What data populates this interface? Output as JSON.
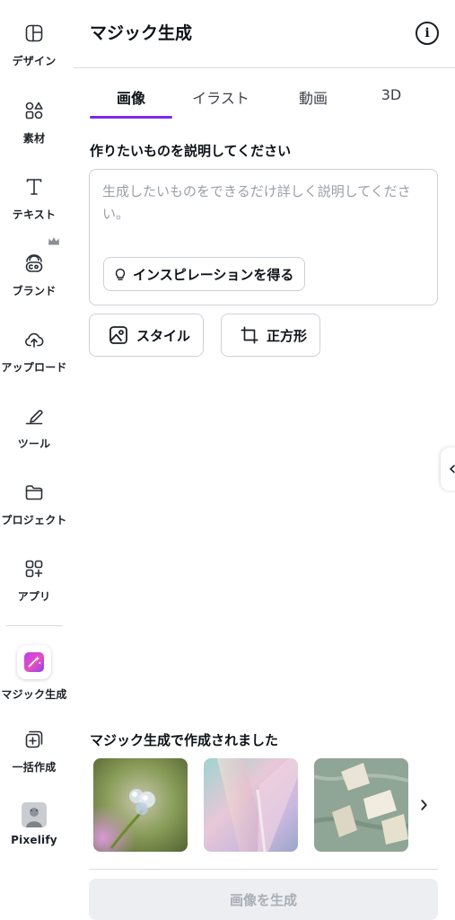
{
  "sidebar": {
    "items": [
      {
        "label": "デザイン",
        "icon": "layout-icon"
      },
      {
        "label": "素材",
        "icon": "shapes-icon"
      },
      {
        "label": "テキスト",
        "icon": "text-icon"
      },
      {
        "label": "ブランド",
        "icon": "brand-icon"
      },
      {
        "label": "アップロード",
        "icon": "cloud-upload-icon"
      },
      {
        "label": "ツール",
        "icon": "pen-tool-icon"
      },
      {
        "label": "プロジェクト",
        "icon": "folder-icon"
      },
      {
        "label": "アプリ",
        "icon": "apps-grid-icon"
      },
      {
        "label": "マジック生成",
        "icon": "magic-sparkle-icon",
        "active": true
      },
      {
        "label": "一括作成",
        "icon": "bulk-create-icon"
      },
      {
        "label": "Pixelify",
        "icon": "pixelify-app-icon"
      }
    ]
  },
  "panel": {
    "title": "マジック生成",
    "tabs": [
      {
        "label": "画像",
        "active": true
      },
      {
        "label": "イラスト"
      },
      {
        "label": "動画"
      },
      {
        "label": "3D"
      }
    ],
    "prompt": {
      "heading": "作りたいものを説明してください",
      "placeholder": "生成したいものをできるだけ詳しく説明してください。",
      "value": "",
      "inspiration_label": "インスピレーションを得る"
    },
    "options": {
      "style_label": "スタイル",
      "aspect_label": "正方形"
    },
    "gallery": {
      "heading": "マジック生成で作成されました",
      "items": [
        {
          "subject": "water droplets on flower bud"
        },
        {
          "subject": "iridescent glass shards"
        },
        {
          "subject": "green marble with white stone pieces"
        }
      ]
    },
    "generate_label": "画像を生成"
  },
  "colors": {
    "accent": "#7d2ae8",
    "magic_gradient": [
      "#c13cf0",
      "#8b3ff0"
    ],
    "disabled_button_bg": "#eceef1",
    "disabled_button_text": "#a9aeb5"
  }
}
